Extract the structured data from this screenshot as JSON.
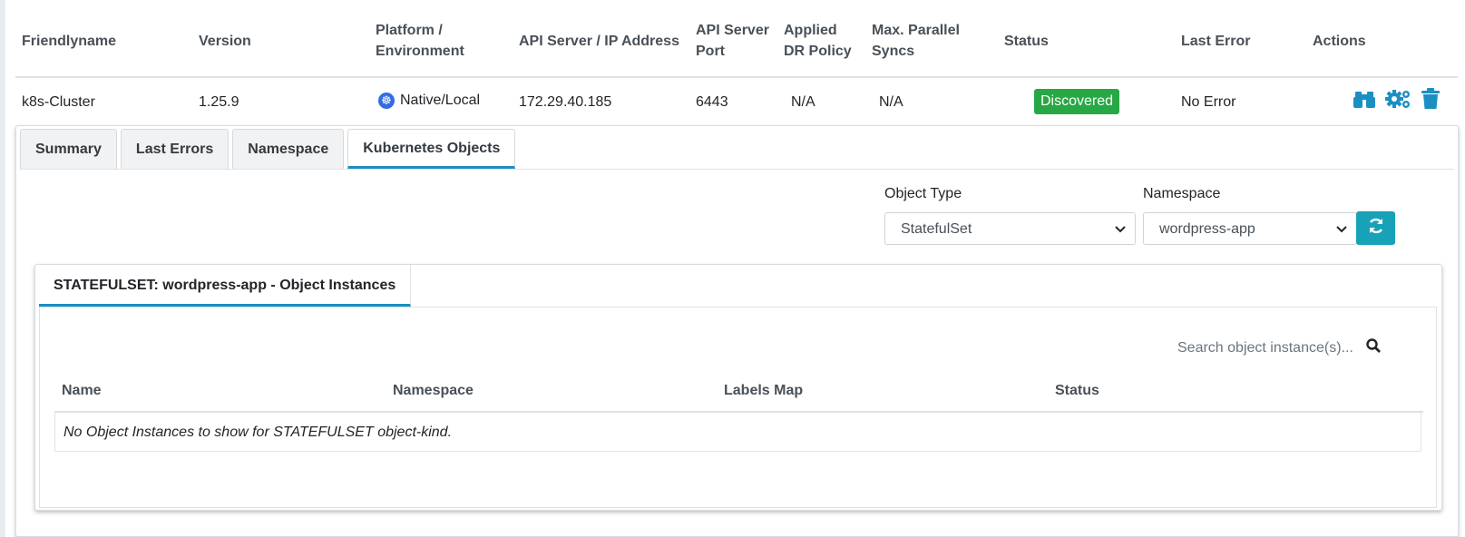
{
  "cluster_table": {
    "headers": {
      "friendlyname": "Friendlyname",
      "version": "Version",
      "platform_line1": "Platform /",
      "platform_line2": "Environment",
      "api_server": "API Server / IP Address",
      "api_port_line1": "API Server",
      "api_port_line2": "Port",
      "dr_line1": "Applied",
      "dr_line2": "DR Policy",
      "syncs_line1": "Max. Parallel",
      "syncs_line2": "Syncs",
      "status": "Status",
      "last_error": "Last Error",
      "actions": "Actions"
    },
    "row": {
      "friendlyname": "k8s-Cluster",
      "version": "1.25.9",
      "platform": "Native/Local",
      "platform_icon": "kubernetes-icon",
      "api_server": "172.29.40.185",
      "api_port": "6443",
      "dr_policy": "N/A",
      "parallel_syncs": "N/A",
      "status": "Discovered",
      "last_error": "No Error"
    },
    "action_icons": [
      "binoculars-icon",
      "gears-icon",
      "trash-icon"
    ],
    "colors": {
      "status_badge": "#28a745",
      "action_icon": "#1b8fc2"
    }
  },
  "tabs": [
    {
      "label": "Summary"
    },
    {
      "label": "Last Errors"
    },
    {
      "label": "Namespace"
    },
    {
      "label": "Kubernetes Objects",
      "active": true
    }
  ],
  "filters": {
    "object_type_label": "Object Type",
    "object_type_value": "StatefulSet",
    "namespace_label": "Namespace",
    "namespace_value": "wordpress-app",
    "refresh_icon": "refresh-icon"
  },
  "instances_panel": {
    "tab_label": "STATEFULSET: wordpress-app - Object Instances",
    "search_placeholder": "Search object instance(s)...",
    "columns": [
      "Name",
      "Namespace",
      "Labels Map",
      "Status"
    ],
    "empty_message": "No Object Instances to show for STATEFULSET object-kind."
  }
}
